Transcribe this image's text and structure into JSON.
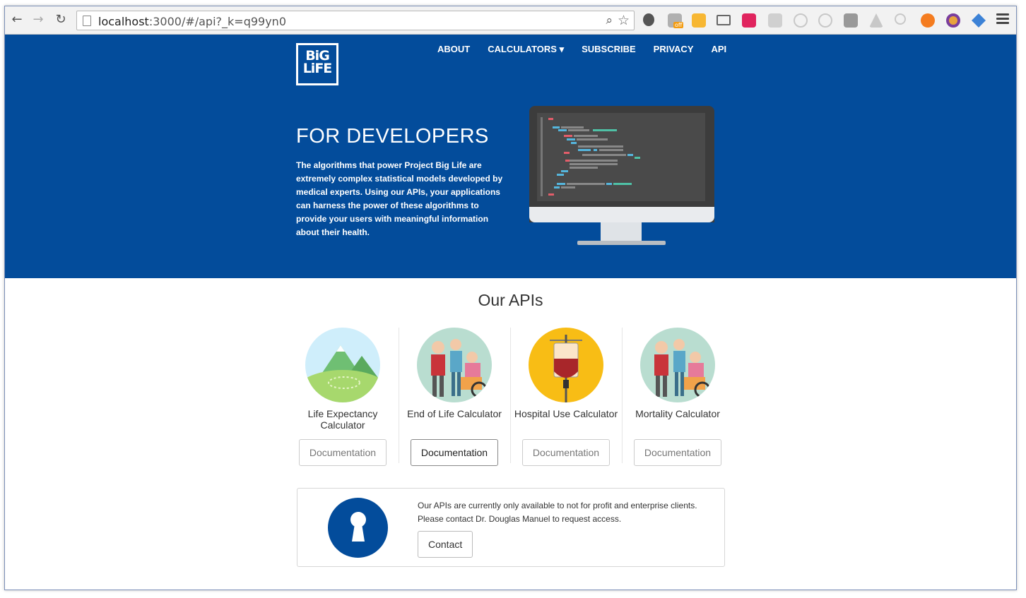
{
  "browser": {
    "url_host": "localhost",
    "url_rest": ":3000/#/api?_k=q99yn0"
  },
  "nav": {
    "items": [
      {
        "label": "ABOUT"
      },
      {
        "label": "CALCULATORS ▾"
      },
      {
        "label": "SUBSCRIBE"
      },
      {
        "label": "PRIVACY"
      },
      {
        "label": "API"
      }
    ]
  },
  "logo": {
    "text_top": "BiG",
    "text_bottom": "LiFE"
  },
  "hero": {
    "title": "FOR DEVELOPERS",
    "body": "The algorithms that power Project Big Life are extremely complex statistical models developed by medical experts. Using our APIs, your applications can harness the power of these algorithms to provide your users with meaningful information about their health."
  },
  "apis": {
    "title": "Our APIs",
    "items": [
      {
        "name": "Life Expectancy Calculator",
        "button": "Documentation",
        "image": "landscape-hills"
      },
      {
        "name": "End of Life Calculator",
        "button": "Documentation",
        "image": "elderly-caregiver"
      },
      {
        "name": "Hospital Use Calculator",
        "button": "Documentation",
        "image": "iv-blood-bag"
      },
      {
        "name": "Mortality Calculator",
        "button": "Documentation",
        "image": "elderly-caregiver"
      }
    ]
  },
  "access": {
    "line1": "Our APIs are currently only available to not for profit and enterprise clients.",
    "line2": "Please contact Dr. Douglas Manuel to request access.",
    "button": "Contact"
  },
  "colors": {
    "brand": "#034c9b"
  }
}
